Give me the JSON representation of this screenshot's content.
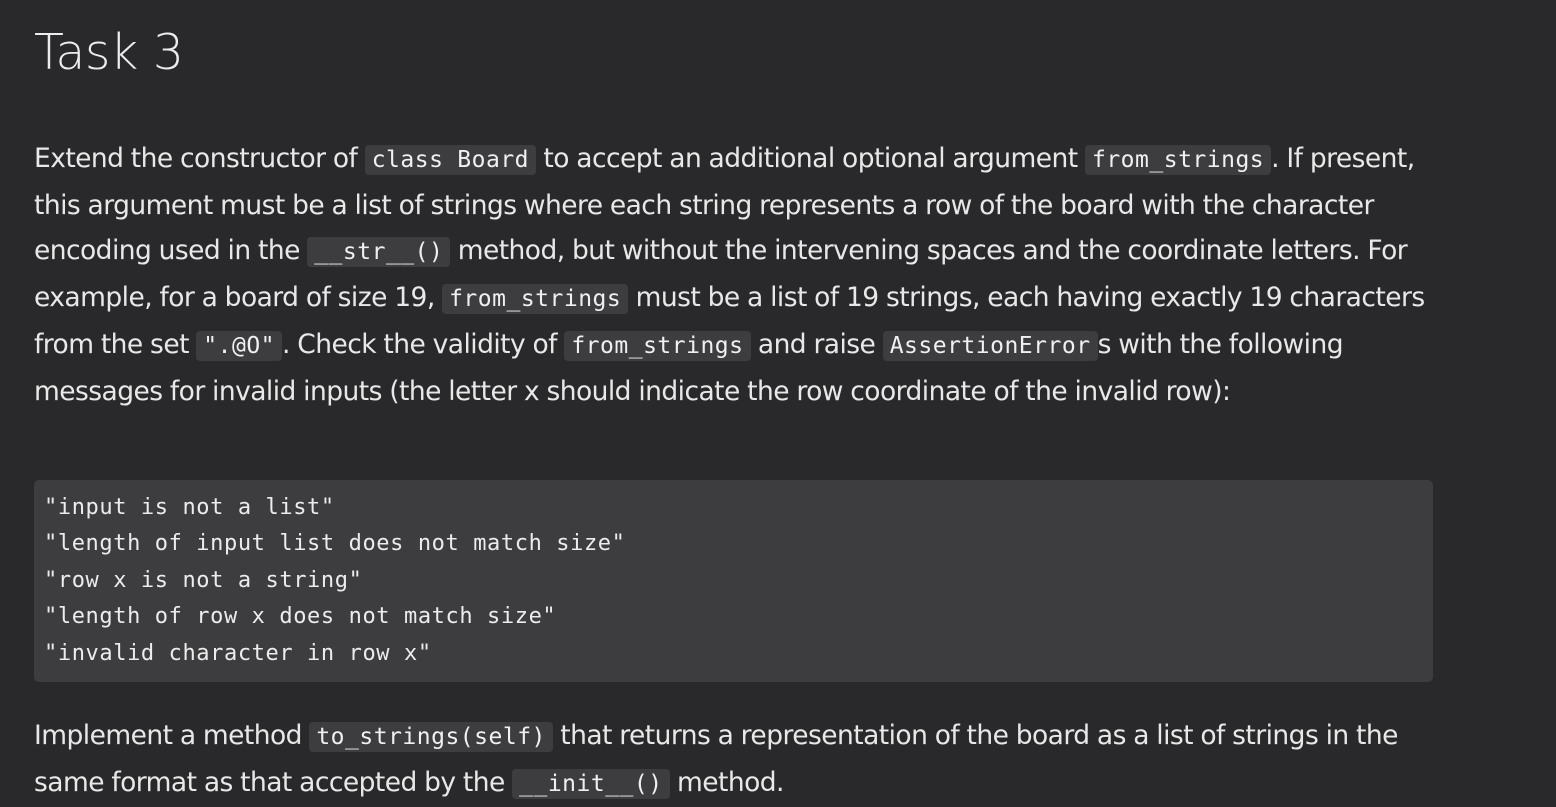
{
  "title": "Task 3",
  "paragraph1": {
    "t1": "Extend the constructor of ",
    "c1": "class Board",
    "t2": " to accept an additional optional argument ",
    "c2": "from_strings",
    "t3": ". If present, this argument must be a list of strings where each string represents a row of the board with the character encoding used in the ",
    "c3": "__str__()",
    "t4": " method, but without the intervening spaces and the coordinate letters. For example, for a board of size 19, ",
    "c4": "from_strings",
    "t5": " must be a list of 19 strings, each having exactly 19 characters from the set ",
    "c5": "\".@O\"",
    "t6": ". Check the validity of ",
    "c6": "from_strings",
    "t7": " and raise ",
    "c7": "AssertionError",
    "t8": "s with the following messages for invalid inputs (the letter x should indicate the row coordinate of the invalid row):"
  },
  "error_messages": [
    "\"input is not a list\"",
    "\"length of input list does not match size\"",
    "\"row x is not a string\"",
    "\"length of row x does not match size\"",
    "\"invalid character in row x\""
  ],
  "paragraph2": {
    "t1": "Implement a method ",
    "c1": "to_strings(self)",
    "t2": " that returns a representation of the board as a list of strings in the same format as that accepted by the ",
    "c2": "__init__()",
    "t3": " method."
  }
}
